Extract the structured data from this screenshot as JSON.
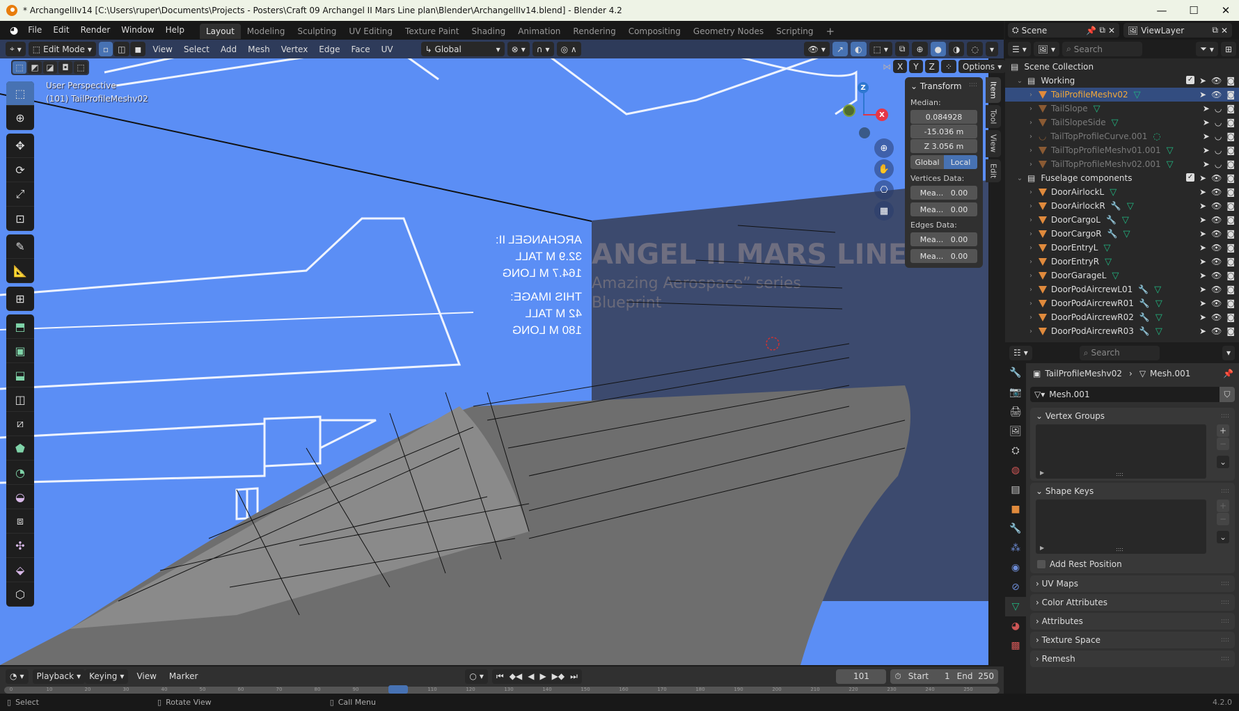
{
  "window": {
    "title": "* ArchangelIIv14 [C:\\Users\\ruper\\Documents\\Projects - Posters\\Craft 09 Archangel II Mars Line plan\\Blender\\ArchangelIIv14.blend] - Blender 4.2",
    "controls": {
      "minimize": "—",
      "maximize": "☐",
      "close": "✕"
    }
  },
  "menu": [
    "File",
    "Edit",
    "Render",
    "Window",
    "Help"
  ],
  "workspaces": [
    {
      "label": "Layout",
      "active": true
    },
    {
      "label": "Modeling"
    },
    {
      "label": "Sculpting"
    },
    {
      "label": "UV Editing"
    },
    {
      "label": "Texture Paint"
    },
    {
      "label": "Shading"
    },
    {
      "label": "Animation"
    },
    {
      "label": "Rendering"
    },
    {
      "label": "Compositing"
    },
    {
      "label": "Geometry Nodes"
    },
    {
      "label": "Scripting"
    },
    {
      "label": "+"
    }
  ],
  "viewport_header": {
    "mode": "Edit Mode",
    "menus": [
      "View",
      "Select",
      "Add",
      "Mesh",
      "Vertex",
      "Edge",
      "Face",
      "UV"
    ],
    "orientation": "Global",
    "mirror_axes": [
      "X",
      "Y",
      "Z"
    ],
    "options_label": "Options"
  },
  "viewport": {
    "perspective_label": "User Perspective",
    "object_label": "(101) TailProfileMeshv02",
    "background_color": "#5b8ef5",
    "blueprint_text": {
      "headline": "ANGEL II MARS LINE",
      "subtitle": "Amazing Aerospace” series",
      "subtitle2": "Blueprint",
      "mirrored_lines": [
        "ARCHANGEL II:",
        "32.9 M TALL",
        "164.7 M LONG",
        "THIS IMAGE:",
        "42 M TALL",
        "180 M LONG"
      ]
    },
    "gizmo": {
      "x": "X",
      "z": "Z"
    }
  },
  "n_panel": {
    "title": "Transform",
    "median_label": "Median:",
    "median": [
      "0.084928",
      "-15.036 m",
      "Z   3.056 m"
    ],
    "space_options": [
      "Global",
      "Local"
    ],
    "space_active": "Local",
    "vertices_label": "Vertices Data:",
    "vertices": [
      {
        "label": "Mea...",
        "value": "0.00"
      },
      {
        "label": "Mea...",
        "value": "0.00"
      }
    ],
    "edges_label": "Edges Data:",
    "edges": [
      {
        "label": "Mea...",
        "value": "0.00"
      },
      {
        "label": "Mea...",
        "value": "0.00"
      }
    ],
    "tabs": [
      "Item",
      "Tool",
      "View",
      "Edit"
    ],
    "active_tab": "Item"
  },
  "topright": {
    "scene": "Scene",
    "view_layer": "ViewLayer"
  },
  "outliner": {
    "search_placeholder": "Search",
    "root": "Scene Collection",
    "collections": [
      {
        "name": "Working",
        "items": [
          {
            "name": "TailProfileMeshv02",
            "selected": true,
            "type": "mesh",
            "wrench": false,
            "visible": true
          },
          {
            "name": "TailSlope",
            "dim": true,
            "type": "mesh",
            "wrench": false,
            "visible": false
          },
          {
            "name": "TailSlopeSide",
            "dim": true,
            "type": "mesh",
            "wrench": false,
            "visible": false
          },
          {
            "name": "TailTopProfileCurve.001",
            "dim": true,
            "type": "curve",
            "wrench": false,
            "visible": false
          },
          {
            "name": "TailTopProfileMeshv01.001",
            "dim": true,
            "type": "mesh",
            "wrench": false,
            "visible": false
          },
          {
            "name": "TailTopProfileMeshv02.001",
            "dim": true,
            "type": "mesh",
            "wrench": false,
            "visible": false
          }
        ]
      },
      {
        "name": "Fuselage components",
        "items": [
          {
            "name": "DoorAirlockL",
            "wrench": false,
            "visible": true
          },
          {
            "name": "DoorAirlockR",
            "wrench": true,
            "visible": true
          },
          {
            "name": "DoorCargoL",
            "wrench": true,
            "visible": true
          },
          {
            "name": "DoorCargoR",
            "wrench": true,
            "visible": true
          },
          {
            "name": "DoorEntryL",
            "wrench": false,
            "visible": true
          },
          {
            "name": "DoorEntryR",
            "wrench": false,
            "visible": true
          },
          {
            "name": "DoorGarageL",
            "wrench": false,
            "visible": true
          },
          {
            "name": "DoorPodAircrewL01",
            "wrench": true,
            "visible": true
          },
          {
            "name": "DoorPodAircrewR01",
            "wrench": true,
            "visible": true
          },
          {
            "name": "DoorPodAircrewR02",
            "wrench": true,
            "visible": true
          },
          {
            "name": "DoorPodAircrewR03",
            "wrench": true,
            "visible": true
          }
        ]
      }
    ]
  },
  "properties": {
    "search_placeholder": "Search",
    "breadcrumb": {
      "object": "TailProfileMeshv02",
      "data": "Mesh.001"
    },
    "mesh_name": "Mesh.001",
    "panels": [
      {
        "label": "Vertex Groups",
        "open": true
      },
      {
        "label": "Shape Keys",
        "open": true
      },
      {
        "label": "UV Maps",
        "open": false
      },
      {
        "label": "Color Attributes",
        "open": false
      },
      {
        "label": "Attributes",
        "open": false
      },
      {
        "label": "Texture Space",
        "open": false
      },
      {
        "label": "Remesh",
        "open": false
      }
    ],
    "add_rest_position": "Add Rest Position"
  },
  "timeline": {
    "menus": [
      "Playback",
      "Keying",
      "View",
      "Marker"
    ],
    "current_frame": "101",
    "start_label": "Start",
    "start": "1",
    "end_label": "End",
    "end": "250",
    "ticks": [
      "0",
      "10",
      "20",
      "30",
      "40",
      "50",
      "60",
      "70",
      "80",
      "90",
      "100",
      "110",
      "120",
      "130",
      "140",
      "150",
      "160",
      "170",
      "180",
      "190",
      "200",
      "210",
      "220",
      "230",
      "240",
      "250"
    ]
  },
  "statusbar": {
    "hints": [
      "Select",
      "Rotate View",
      "Call Menu"
    ],
    "version": "4.2.0"
  }
}
